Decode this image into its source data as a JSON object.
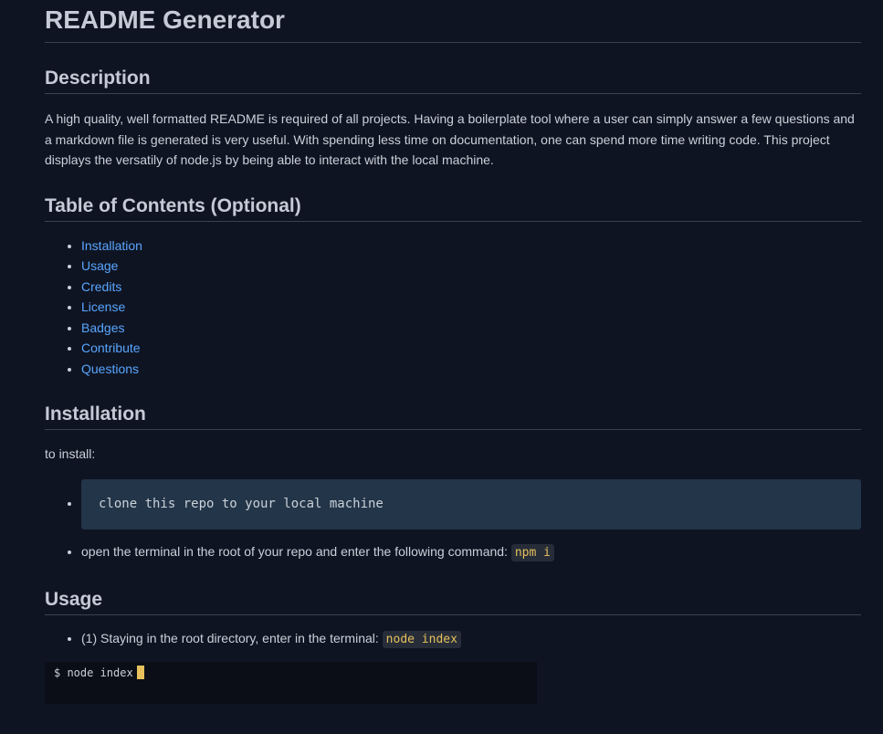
{
  "title": "README Generator",
  "description": {
    "heading": "Description",
    "text": "A high quality, well formatted README is required of all projects. Having a boilerplate tool where a user can simply answer a few questions and a markdown file is generated is very useful. With spending less time on documentation, one can spend more time writing code. This project displays the versatily of node.js by being able to interact with the local machine."
  },
  "toc": {
    "heading": "Table of Contents (Optional)",
    "items": [
      "Installation",
      "Usage",
      "Credits",
      "License",
      "Badges",
      "Contribute",
      "Questions"
    ]
  },
  "installation": {
    "heading": "Installation",
    "intro": "to install:",
    "step1_code": "clone this repo to your local machine",
    "step2_text": "open the terminal in the root of your repo and enter the following command:",
    "step2_code": "npm i"
  },
  "usage": {
    "heading": "Usage",
    "step1_text": "(1) Staying in the root directory, enter in the terminal:",
    "step1_code": "node index",
    "terminal_line": "$ node index"
  },
  "colors": {
    "background": "#0f1422",
    "link": "#58a6ff",
    "code_highlight": "#e6c15c",
    "code_block_bg": "#233548"
  }
}
